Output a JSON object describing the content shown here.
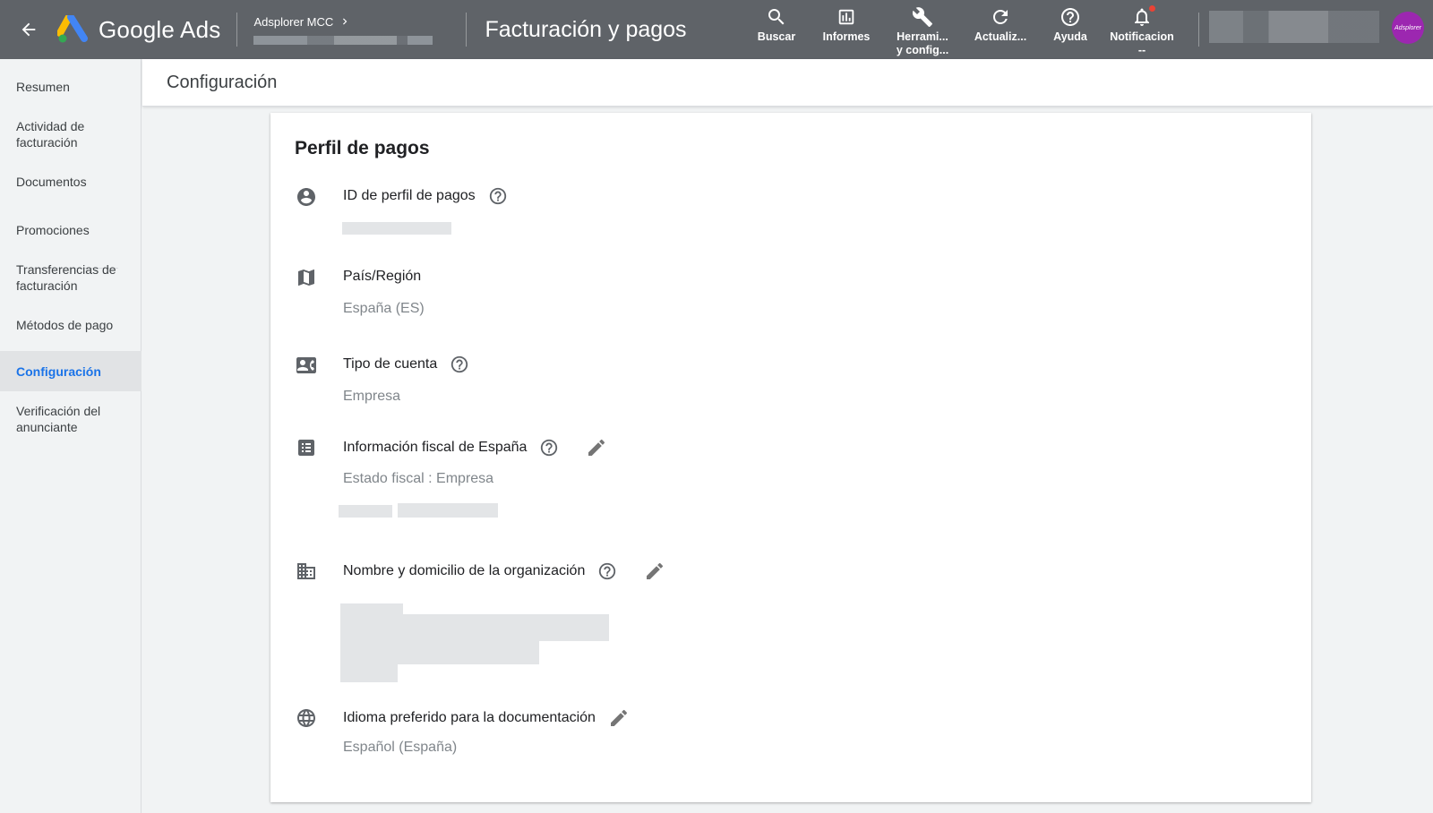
{
  "header": {
    "brand": "Google Ads",
    "account_name": "Adsplorer MCC",
    "page_title": "Facturación y pagos",
    "actions": [
      {
        "label_line1": "Buscar",
        "label_line2": ""
      },
      {
        "label_line1": "Informes",
        "label_line2": ""
      },
      {
        "label_line1": "Herrami...",
        "label_line2": "y config..."
      },
      {
        "label_line1": "Actualiz...",
        "label_line2": ""
      },
      {
        "label_line1": "Ayuda",
        "label_line2": ""
      },
      {
        "label_line1": "Notificacion",
        "label_line2": "--"
      }
    ],
    "avatar_text": "Adsplorer"
  },
  "sidebar": {
    "items": [
      {
        "label": "Resumen"
      },
      {
        "label": "Actividad de facturación"
      },
      {
        "label": "Documentos"
      },
      {
        "label": "Promociones"
      },
      {
        "label": "Transferencias de facturación"
      },
      {
        "label": "Métodos de pago"
      },
      {
        "label": "Configuración"
      },
      {
        "label": "Verificación del anunciante"
      }
    ]
  },
  "subheader": {
    "title": "Configuración"
  },
  "profile": {
    "title": "Perfil de pagos",
    "rows": [
      {
        "label": "ID de perfil de pagos",
        "value": ""
      },
      {
        "label": "País/Región",
        "value": "España (ES)"
      },
      {
        "label": "Tipo de cuenta",
        "value": "Empresa"
      },
      {
        "label": "Información fiscal de España",
        "value": "Estado fiscal : Empresa"
      },
      {
        "label": "Nombre y domicilio de la organización",
        "value": ""
      },
      {
        "label": "Idioma preferido para la documentación",
        "value": "Español (España)"
      }
    ]
  },
  "colors": {
    "topbar": "#5f6368",
    "accent": "#1a73e8",
    "background": "#f1f3f4"
  }
}
